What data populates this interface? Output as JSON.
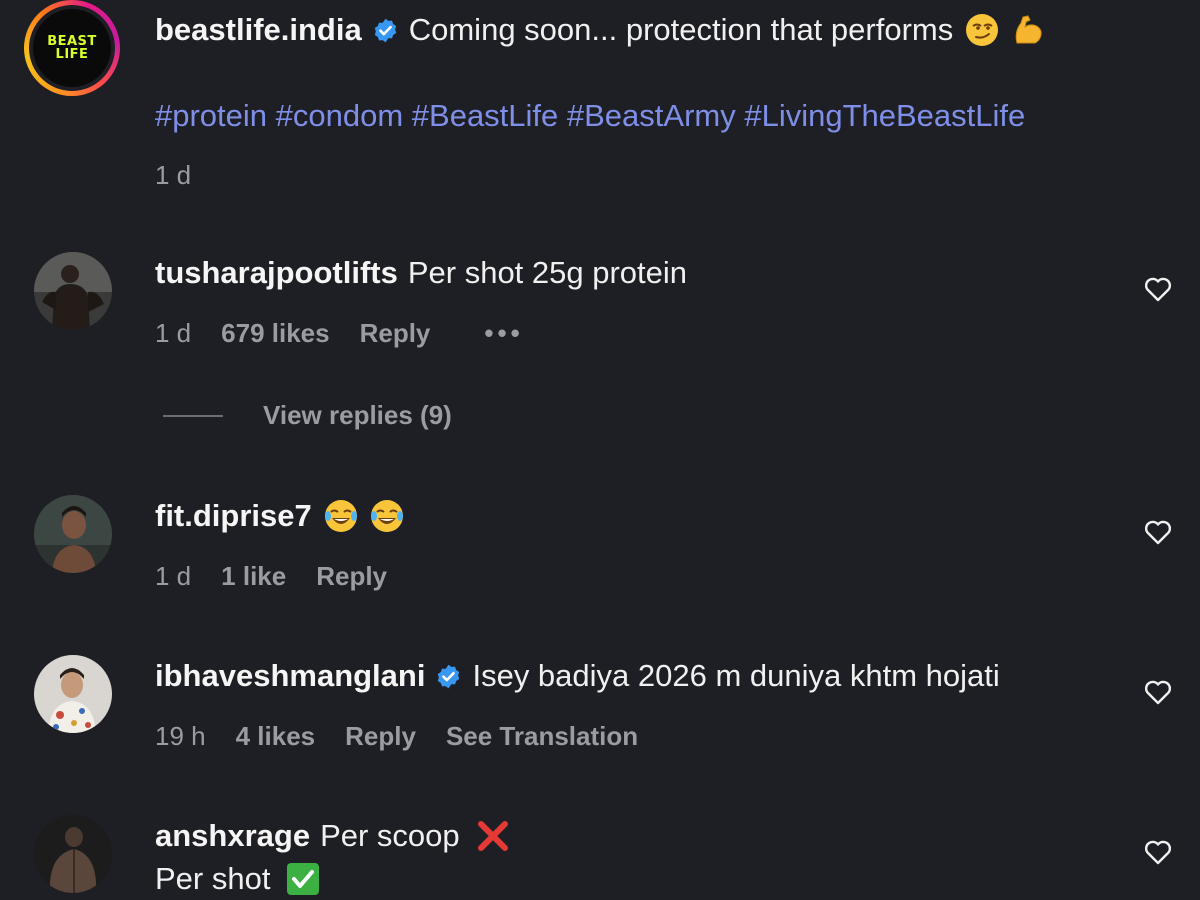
{
  "caption": {
    "avatar_logo_line1": "BEAST",
    "avatar_logo_line2": "LIFE",
    "username": "beastlife.india",
    "verified": true,
    "text": "Coming soon... protection that performs",
    "emojis": [
      "smirking-face",
      "flexed-biceps"
    ],
    "hashtags": "#protein #condom #BeastLife #BeastArmy #LivingTheBeastLife",
    "time": "1 d",
    "brand_color": "#d8ff2a",
    "hashtag_color": "#7f8fe8"
  },
  "comments": [
    {
      "username": "tusharajpootlifts",
      "text": "Per shot 25g protein",
      "time": "1 d",
      "likes": "679 likes",
      "reply": "Reply",
      "more": "•••",
      "view_replies": "View replies (9)"
    },
    {
      "username": "fit.diprise7",
      "emojis": [
        "face-with-tears-of-joy",
        "face-with-tears-of-joy"
      ],
      "time": "1 d",
      "likes": "1 like",
      "reply": "Reply"
    },
    {
      "username": "ibhaveshmanglani",
      "verified": true,
      "text": "Isey badiya 2026 m duniya khtm hojati",
      "time": "19 h",
      "likes": "4 likes",
      "reply": "Reply",
      "translation": "See Translation"
    },
    {
      "username": "anshxrage",
      "text": "Per scoop",
      "emoji1": "cross-mark",
      "text2": "Per shot",
      "emoji2": "check-mark-button"
    }
  ],
  "colors": {
    "background": "#1e1f24",
    "muted_text": "#9a9ca3",
    "verified_blue": "#3897f0"
  }
}
